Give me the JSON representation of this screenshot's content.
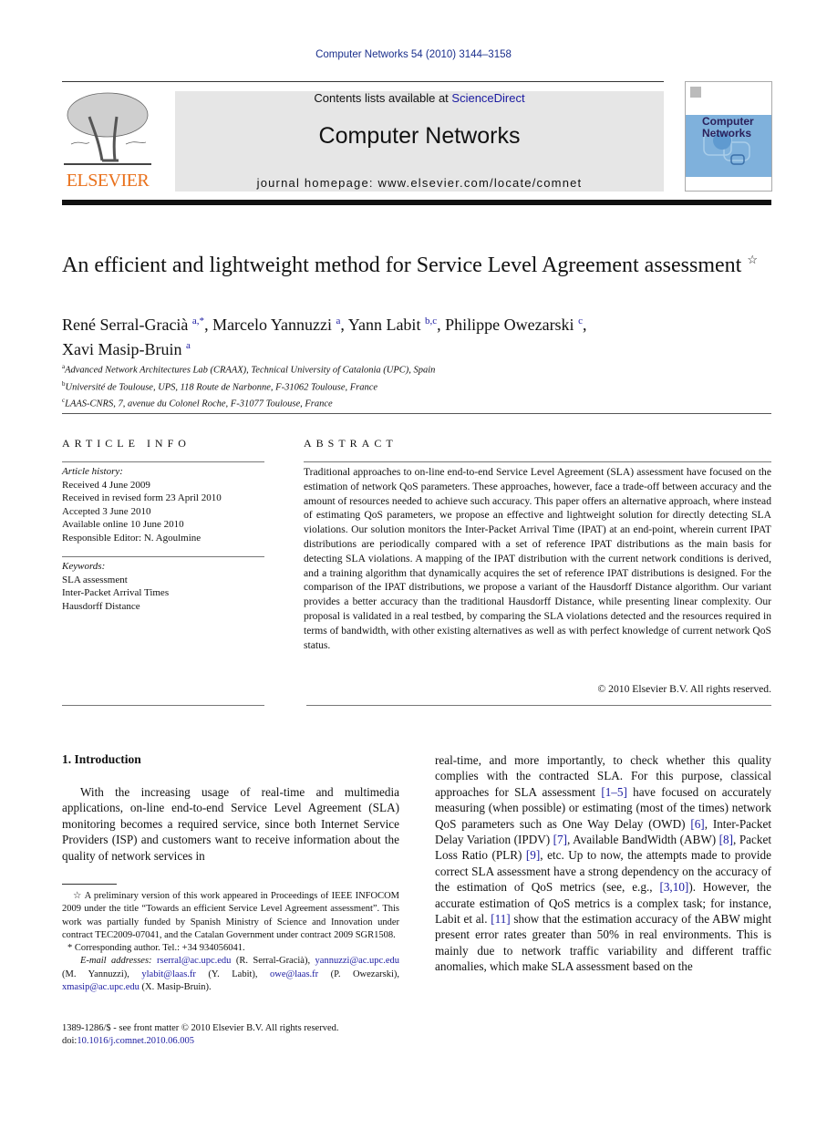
{
  "header": {
    "citation": "Computer Networks 54 (2010) 3144–3158",
    "publisher_logo_text": "ELSEVIER",
    "contents_prefix": "Contents lists available at ",
    "contents_link": "ScienceDirect",
    "journal_name": "Computer Networks",
    "homepage": "journal homepage: www.elsevier.com/locate/comnet",
    "cover_line1": "Computer",
    "cover_line2": "Networks"
  },
  "colors": {
    "link": "#1a1aa0",
    "elsevier_orange": "#e9711c",
    "banner_gray": "#e6e6e6",
    "cover_blue": "#7fb1dc"
  },
  "article": {
    "title": "An efficient and lightweight method for Service Level Agreement assessment",
    "title_mark": "☆",
    "authors": [
      {
        "name": "René Serral-Gracià",
        "aff": "a,*",
        "sep": ", "
      },
      {
        "name": "Marcelo Yannuzzi",
        "aff": "a",
        "sep": ", "
      },
      {
        "name": "Yann Labit",
        "aff": "b,c",
        "sep": ", "
      },
      {
        "name": "Philippe Owezarski",
        "aff": "c",
        "sep": ","
      },
      {
        "name": "Xavi Masip-Bruin",
        "aff": "a",
        "sep": ""
      }
    ],
    "affiliations": [
      {
        "key": "a",
        "text": "Advanced Network Architectures Lab (CRAAX), Technical University of Catalonia (UPC), Spain"
      },
      {
        "key": "b",
        "text": "Université de Toulouse, UPS, 118 Route de Narbonne, F-31062 Toulouse, France"
      },
      {
        "key": "c",
        "text": "LAAS-CNRS, 7, avenue du Colonel Roche, F-31077 Toulouse, France"
      }
    ]
  },
  "article_info": {
    "heading": "ARTICLE INFO",
    "history_label": "Article history:",
    "history": [
      "Received 4 June 2009",
      "Received in revised form 23 April 2010",
      "Accepted 3 June 2010",
      "Available online 10 June 2010",
      "Responsible Editor: N. Agoulmine"
    ],
    "keywords_label": "Keywords:",
    "keywords": [
      "SLA assessment",
      "Inter-Packet Arrival Times",
      "Hausdorff Distance"
    ]
  },
  "abstract": {
    "heading": "ABSTRACT",
    "text": "Traditional approaches to on-line end-to-end Service Level Agreement (SLA) assessment have focused on the estimation of network QoS parameters. These approaches, however, face a trade-off between accuracy and the amount of resources needed to achieve such accuracy. This paper offers an alternative approach, where instead of estimating QoS parameters, we propose an effective and lightweight solution for directly detecting SLA violations. Our solution monitors the Inter-Packet Arrival Time (IPAT) at an end-point, wherein current IPAT distributions are periodically compared with a set of reference IPAT distributions as the main basis for detecting SLA violations. A mapping of the IPAT distribution with the current network conditions is derived, and a training algorithm that dynamically acquires the set of reference IPAT distributions is designed. For the comparison of the IPAT distributions, we propose a variant of the Hausdorff Distance algorithm. Our variant provides a better accuracy than the traditional Hausdorff Distance, while presenting linear complexity. Our proposal is validated in a real testbed, by comparing the SLA violations detected and the resources required in terms of bandwidth, with other existing alternatives as well as with perfect knowledge of current network QoS status.",
    "copyright": "© 2010 Elsevier B.V. All rights reserved."
  },
  "introduction": {
    "heading": "1. Introduction",
    "left_text": "With the increasing usage of real-time and multimedia applications, on-line end-to-end Service Level Agreement (SLA) monitoring becomes a required service, since both Internet Service Providers (ISP) and customers want to receive information about the quality of network services in",
    "right_segments": [
      {
        "t": "real-time, and more importantly, to check whether this quality complies with the contracted SLA. For this purpose, classical approaches for SLA assessment "
      },
      {
        "ref": "[1–5]"
      },
      {
        "t": " have focused on accurately measuring (when possible) or estimating (most of the times) network QoS parameters such as One Way Delay (OWD) "
      },
      {
        "ref": "[6]"
      },
      {
        "t": ", Inter-Packet Delay Variation (IPDV) "
      },
      {
        "ref": "[7]"
      },
      {
        "t": ", Available BandWidth (ABW) "
      },
      {
        "ref": "[8]"
      },
      {
        "t": ", Packet Loss Ratio (PLR) "
      },
      {
        "ref": "[9]"
      },
      {
        "t": ", etc. Up to now, the attempts made to provide correct SLA assessment have a strong dependency on the accuracy of the estimation of QoS metrics (see, e.g., "
      },
      {
        "ref": "[3,10]"
      },
      {
        "t": "). However, the accurate estimation of QoS metrics is a complex task; for instance, Labit et al. "
      },
      {
        "ref": "[11]"
      },
      {
        "t": " show that the estimation accuracy of the ABW might present error rates greater than 50% in real environments. This is mainly due to network traffic variability and different traffic anomalies, which make SLA assessment based on the"
      }
    ]
  },
  "footnotes": {
    "star_note": "☆ A preliminary version of this work appeared in Proceedings of IEEE INFOCOM 2009 under the title “Towards an efficient Service Level Agreement assessment”. This work was partially funded by Spanish Ministry of Science and Innovation under contract TEC2009-07041, and the Catalan Government under contract 2009 SGR1508.",
    "corresponding": "* Corresponding author. Tel.: +34 934056041.",
    "email_label": "E-mail addresses:",
    "emails": [
      {
        "addr": "rserral@ac.upc.edu",
        "who": " (R. Serral-Gracià), "
      },
      {
        "addr": "yannuzzi@ac.upc.edu",
        "who": " (M. Yannuzzi), "
      },
      {
        "addr": "ylabit@laas.fr",
        "who": " (Y. Labit), "
      },
      {
        "addr": "owe@laas.fr",
        "who": " (P. Owezarski), "
      },
      {
        "addr": "xmasip@ac.upc.edu",
        "who": " (X. Masip-Bruin)."
      }
    ],
    "front_matter": "1389-1286/$ - see front matter © 2010 Elsevier B.V. All rights reserved.",
    "doi_prefix": "doi:",
    "doi": "10.1016/j.comnet.2010.06.005"
  }
}
